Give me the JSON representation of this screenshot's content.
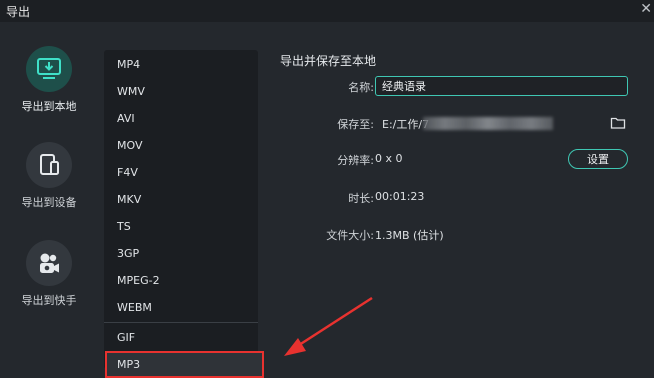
{
  "window": {
    "title": "导出"
  },
  "nav": {
    "items": [
      {
        "label": "导出到本地",
        "icon": "monitor-download-icon",
        "active": true
      },
      {
        "label": "导出到设备",
        "icon": "devices-icon",
        "active": false
      },
      {
        "label": "导出到快手",
        "icon": "kuaishou-camera-icon",
        "active": false
      }
    ]
  },
  "formats": {
    "items": [
      "MP4",
      "WMV",
      "AVI",
      "MOV",
      "F4V",
      "MKV",
      "TS",
      "3GP",
      "MPEG-2",
      "WEBM",
      "GIF",
      "MP3"
    ],
    "selected": "MP3"
  },
  "export": {
    "section_title": "导出并保存至本地",
    "name_label": "名称:",
    "name_value": "经典语录",
    "save_label": "保存至:",
    "save_path": "E:/工作/7",
    "resolution_label": "分辨率:",
    "resolution_value": "0 x 0",
    "settings_button": "设置",
    "duration_label": "时长:",
    "duration_value": "00:01:23",
    "filesize_label": "文件大小:",
    "filesize_value": "1.3MB (估计)"
  },
  "colors": {
    "accent": "#3fc7b3",
    "highlight": "#e8322f",
    "background": "#24282d"
  }
}
